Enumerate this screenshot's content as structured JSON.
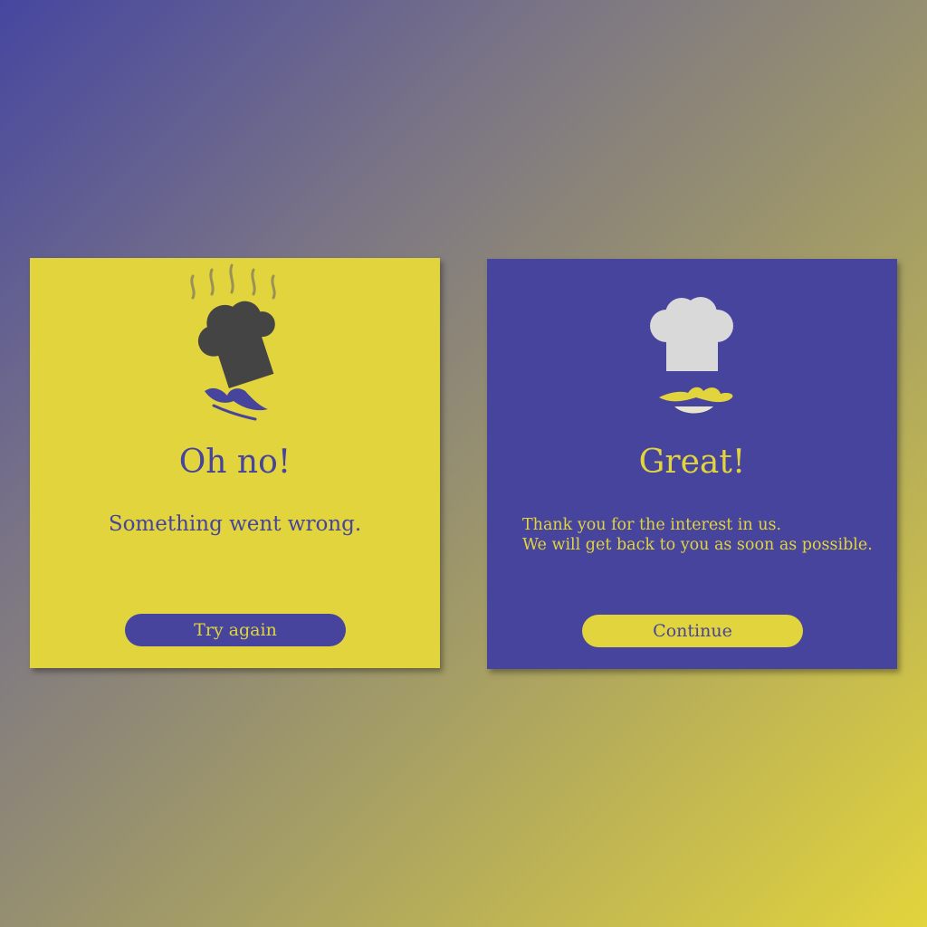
{
  "error_card": {
    "title": "Oh no!",
    "message": "Something went wrong.",
    "button_label": "Try again",
    "background": "#e2d43c",
    "accent": "#46449c",
    "icons": [
      "chef-hat-icon",
      "steam-icon",
      "mustache-icon"
    ]
  },
  "success_card": {
    "title": "Great!",
    "message_lines": [
      "Thank you for the interest in us.",
      "We will get back to you as soon as possible."
    ],
    "button_label": "Continue",
    "background": "#46449c",
    "accent": "#e2d43c",
    "icons": [
      "chef-hat-icon",
      "mustache-icon",
      "smile-icon"
    ]
  }
}
